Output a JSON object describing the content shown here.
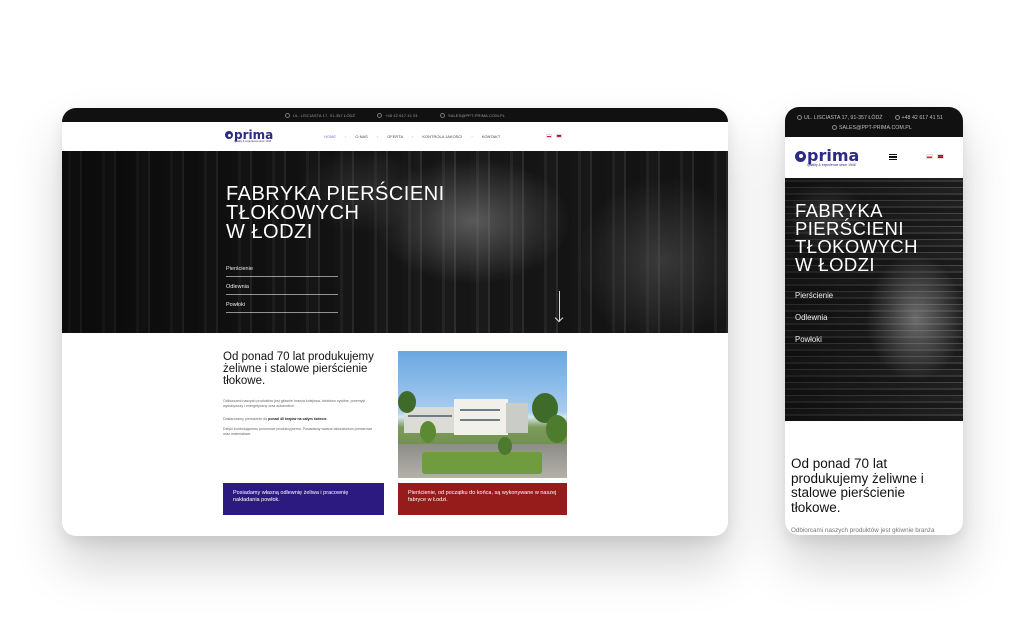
{
  "desktop": {
    "topbar": {
      "address": "UL. LISCIASTA 17, 91-357 ŁÓDŹ",
      "phone": "+48 42 617 41 51",
      "email": "SALES@PPT-PRIMA.COM.PL"
    },
    "logo": {
      "text": "prima",
      "tagline": "Quality & experience since 1946"
    },
    "menu": [
      "HOME",
      "O NAS",
      "OFERTA",
      "KONTROLA JAKOŚCI",
      "KONTAKT"
    ],
    "hero": {
      "title_lines": [
        "FABRYKA PIERŚCIENI",
        "TŁOKOWYCH",
        "W ŁODZI"
      ],
      "links": [
        "Pierścienie",
        "Odlewnia",
        "Powłoki"
      ]
    },
    "content": {
      "heading": "Od ponad 70 lat produkujemy żeliwne i stalowe pierścienie tłokowe.",
      "paragraph1": "Odbiorcami naszych produktów jest głównie branża kolejowa, lotnictwo cywilne, przemysł wydobywczy i energetyczny oraz automotive.",
      "paragraph2_prefix": "Dostarczamy pierścienie do",
      "paragraph2_bold": "ponad 40 krajów na całym świecie.",
      "paragraph3": "Dzięki kontrolującemu procesowi produkcyjnemu. Posiadamy własne laboratorium pomiarowe oraz materiałowe.",
      "box1": "Posiadamy własną odlewnię żeliwa i pracownię nakładania powłok.",
      "box2": "Pierścienie, od początku do końca, są wykonywane w naszej fabryce w Łodzi."
    }
  },
  "mobile": {
    "topbar": {
      "address": "UL. LISCIASTA 17, 91-357 ŁÓDŹ",
      "phone": "+48 42 617 41 51",
      "email": "SALES@PPT-PRIMA.COM.PL"
    },
    "logo": {
      "text": "prima",
      "tagline": "Quality & experience since 1946"
    },
    "hero": {
      "title_lines": [
        "FABRYKA",
        "PIERŚCIENI",
        "TŁOKOWYCH",
        "W  ŁODZI"
      ],
      "links": [
        "Pierścienie",
        "Odlewnia",
        "Powłoki"
      ]
    },
    "content": {
      "heading": "Od ponad 70 lat produkujemy żeliwne i stalowe pierścienie tłokowe.",
      "paragraph": "Odbiorcami naszych produktów jest głównie branża kolejowa, lotnictwo cywilne, przemysł"
    }
  },
  "colors": {
    "brand": "#2d2a85",
    "box_purple": "#2d1a80",
    "box_red": "#961b1b",
    "topbar": "#111111"
  },
  "icons": [
    "location-icon",
    "phone-icon",
    "mail-icon",
    "flag-pl-icon",
    "flag-uk-icon",
    "menu-icon",
    "arrow-down-icon"
  ]
}
